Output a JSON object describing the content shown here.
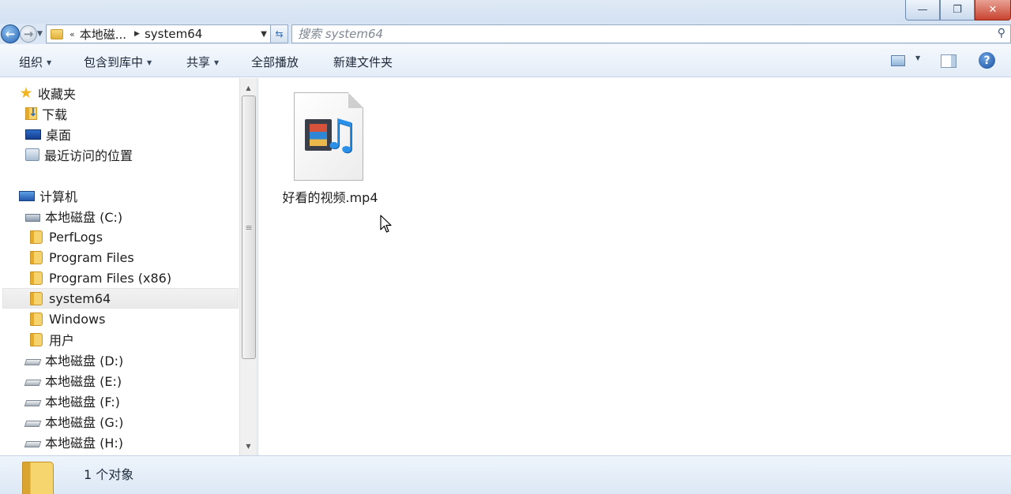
{
  "window": {
    "minimize_glyph": "—",
    "maximize_glyph": "❐",
    "close_glyph": "✕"
  },
  "address_bar": {
    "overflow_glyph": "«",
    "breadcrumb": [
      "本地磁...",
      "system64"
    ],
    "search_placeholder": "搜索 system64"
  },
  "toolbar": {
    "organize": "组织",
    "include_in_library": "包含到库中",
    "share": "共享",
    "play_all": "全部播放",
    "new_folder": "新建文件夹",
    "help_glyph": "?"
  },
  "nav_pane": {
    "favorites": {
      "label": "收藏夹",
      "items": [
        "下载",
        "桌面",
        "最近访问的位置"
      ]
    },
    "computer": {
      "label": "计算机",
      "drive_c": "本地磁盘 (C:)",
      "c_children": [
        "PerfLogs",
        "Program Files",
        "Program Files (x86)",
        "system64",
        "Windows",
        "用户"
      ],
      "selected": "system64",
      "other_drives": [
        "本地磁盘 (D:)",
        "本地磁盘 (E:)",
        "本地磁盘 (F:)",
        "本地磁盘 (G:)",
        "本地磁盘 (H:)"
      ]
    }
  },
  "content": {
    "files": [
      {
        "name": "好看的视频.mp4",
        "icon": "video-file-icon"
      }
    ]
  },
  "status_bar": {
    "text": "1 个对象"
  }
}
